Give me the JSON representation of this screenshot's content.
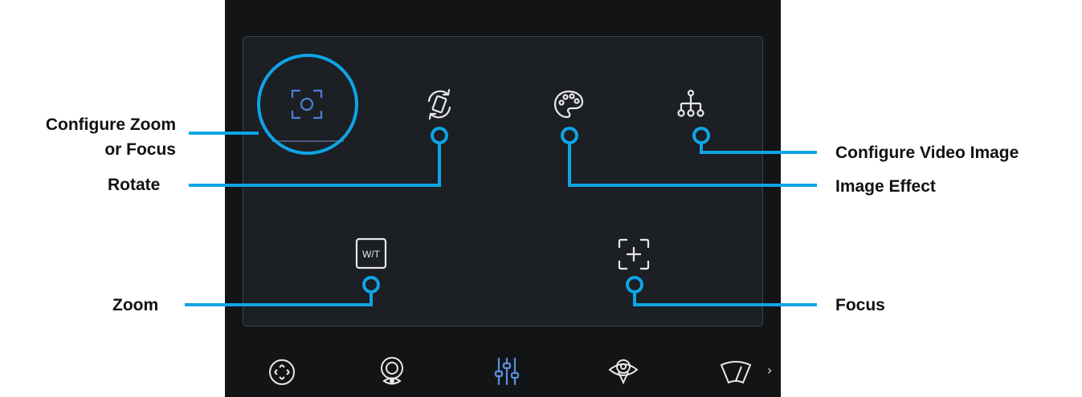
{
  "toolbar": {
    "items": [
      {
        "name": "configure-zoom-focus",
        "icon": "zoom-focus-frame-icon",
        "selected": true
      },
      {
        "name": "rotate",
        "icon": "rotate-icon"
      },
      {
        "name": "image-effect",
        "icon": "palette-icon"
      },
      {
        "name": "configure-video-image",
        "icon": "hierarchy-icon"
      },
      {
        "name": "zoom",
        "icon": "wt-icon",
        "text": "W/T"
      },
      {
        "name": "focus",
        "icon": "focus-plus-icon"
      }
    ]
  },
  "bottom_nav": [
    "ptz-icon",
    "eye-lens-icon",
    "sliders-icon",
    "location-eye-icon",
    "wiper-icon"
  ],
  "callouts": {
    "configure_zoom_focus_line1": "Configure Zoom",
    "configure_zoom_focus_line2": "or Focus",
    "rotate": "Rotate",
    "zoom": "Zoom",
    "configure_video_image": "Configure Video Image",
    "image_effect": "Image Effect",
    "focus": "Focus"
  },
  "colors": {
    "callout": "#0ea5e6",
    "icon": "#e8e8e8",
    "selected_icon": "#4d7fd6",
    "active_nav": "#5b8fe0",
    "panel_border": "#3a4458"
  }
}
